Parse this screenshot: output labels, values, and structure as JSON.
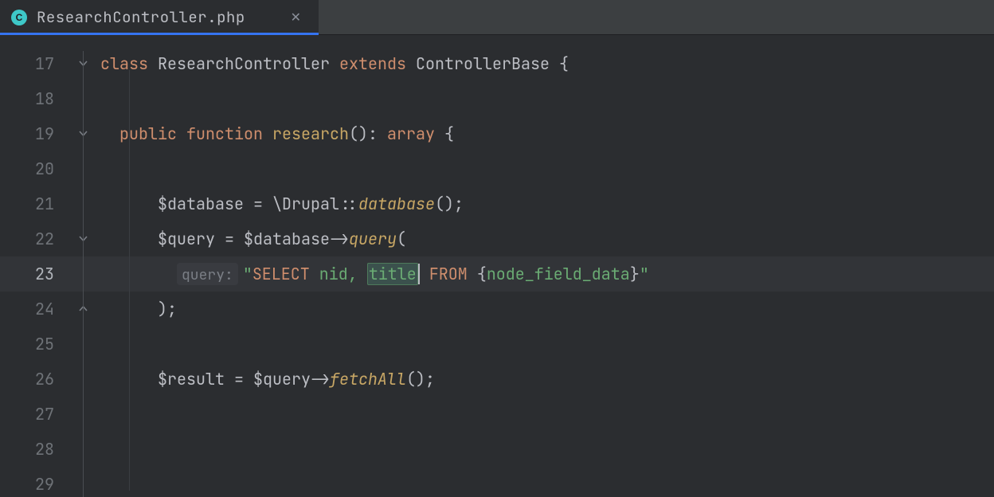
{
  "tab": {
    "icon_letter": "C",
    "title": "ResearchController.php"
  },
  "gutter": {
    "start": 17,
    "count": 13,
    "current": 23
  },
  "code": {
    "l17": {
      "kw1": "class",
      "name": "ResearchController",
      "kw2": "extends",
      "base": "ControllerBase",
      "brace": " {"
    },
    "l19": {
      "kw1": "public",
      "kw2": "function",
      "fn": "research",
      "paren": "()",
      "colon": ": ",
      "type": "array",
      "brace": " {"
    },
    "l21": {
      "var": "$database",
      "eq": " = ",
      "ns": "\\Drupal",
      "dcolon": "::",
      "call": "database",
      "after": "();"
    },
    "l22": {
      "var": "$query",
      "eq": " = ",
      "obj": "$database",
      "arrow": "->",
      "call": "query",
      "after": "("
    },
    "l23": {
      "hint": "query:",
      "q1": "\"",
      "kw1": "SELECT",
      "sp1": " nid, ",
      "sel": "title",
      "sp2": " ",
      "kw2": "FROM",
      "sp3": " ",
      "br1": "{",
      "tbl": "node_field_data",
      "br2": "}",
      "q2": "\""
    },
    "l24": {
      "close": ");"
    },
    "l26": {
      "var": "$result",
      "eq": " = ",
      "obj": "$query",
      "arrow": "->",
      "call": "fetchAll",
      "after": "();"
    }
  }
}
